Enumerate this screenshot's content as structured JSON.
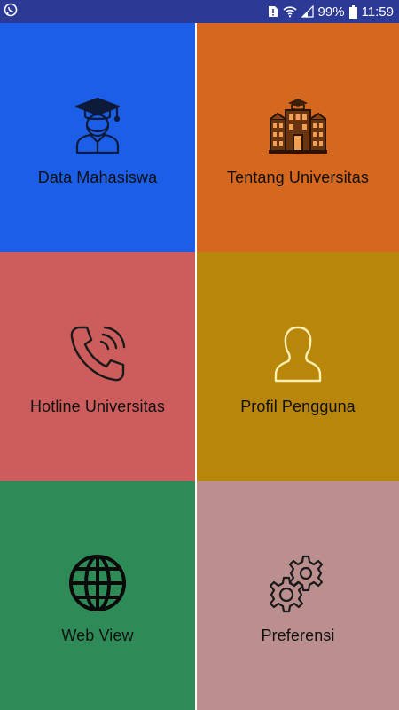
{
  "status_bar": {
    "battery_percent": "99%",
    "time": "11:59",
    "left_icon": "whatsapp-icon"
  },
  "menu": {
    "tiles": [
      {
        "label": "Data Mahasiswa",
        "icon": "graduate-student-icon",
        "color": "#1c5ee8"
      },
      {
        "label": "Tentang Universitas",
        "icon": "university-building-icon",
        "color": "#d5671f"
      },
      {
        "label": "Hotline Universitas",
        "icon": "phone-call-icon",
        "color": "#cd5c5c"
      },
      {
        "label": "Profil Pengguna",
        "icon": "user-profile-icon",
        "color": "#b8860b"
      },
      {
        "label": "Web View",
        "icon": "globe-icon",
        "color": "#2e8b57"
      },
      {
        "label": "Preferensi",
        "icon": "gears-icon",
        "color": "#bc8f8f"
      }
    ]
  }
}
